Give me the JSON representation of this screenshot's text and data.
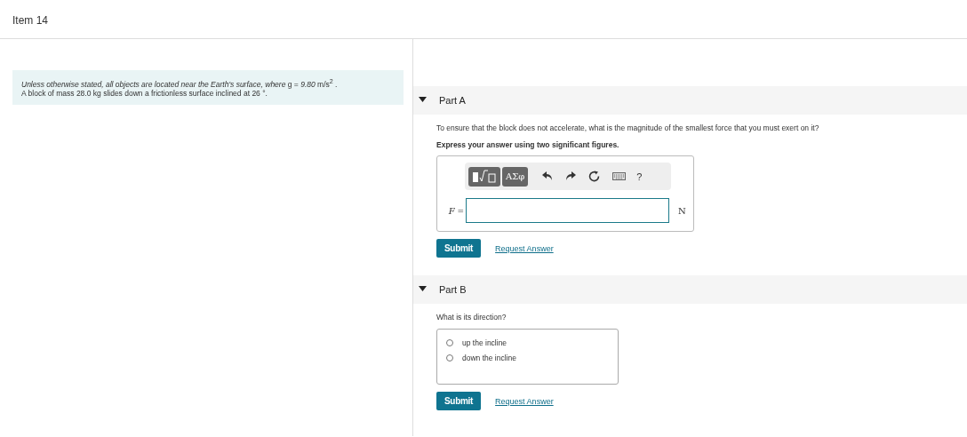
{
  "item_title": "Item 14",
  "intro": {
    "lines": [
      "*Unless otherwise stated, all objects are located near the Earth's surface, where* g = *9.80* m/s$^{2}$ .",
      "A block of mass 28.0 kg slides down a frictionless surface inclined at 26 °."
    ]
  },
  "parts": [
    {
      "kind": "numeric",
      "title": "Part A",
      "expanded": true,
      "question": "To ensure that the block does not accelerate, what is the magnitude of the smallest force that you must exert on it?",
      "instruction": "Express your answer using two significant figures.",
      "toolbar": {
        "template_label": "ΑΣφ",
        "help": "?"
      },
      "variable": "F",
      "equals": "=",
      "unit": "N",
      "submit": "Submit",
      "request": "Request Answer"
    },
    {
      "kind": "choice",
      "title": "Part B",
      "expanded": true,
      "question": "What is its direction?",
      "options": [
        {
          "label": "up the incline",
          "selected": false
        },
        {
          "label": "down the incline",
          "selected": false
        }
      ],
      "submit": "Submit",
      "request": "Request Answer"
    }
  ]
}
